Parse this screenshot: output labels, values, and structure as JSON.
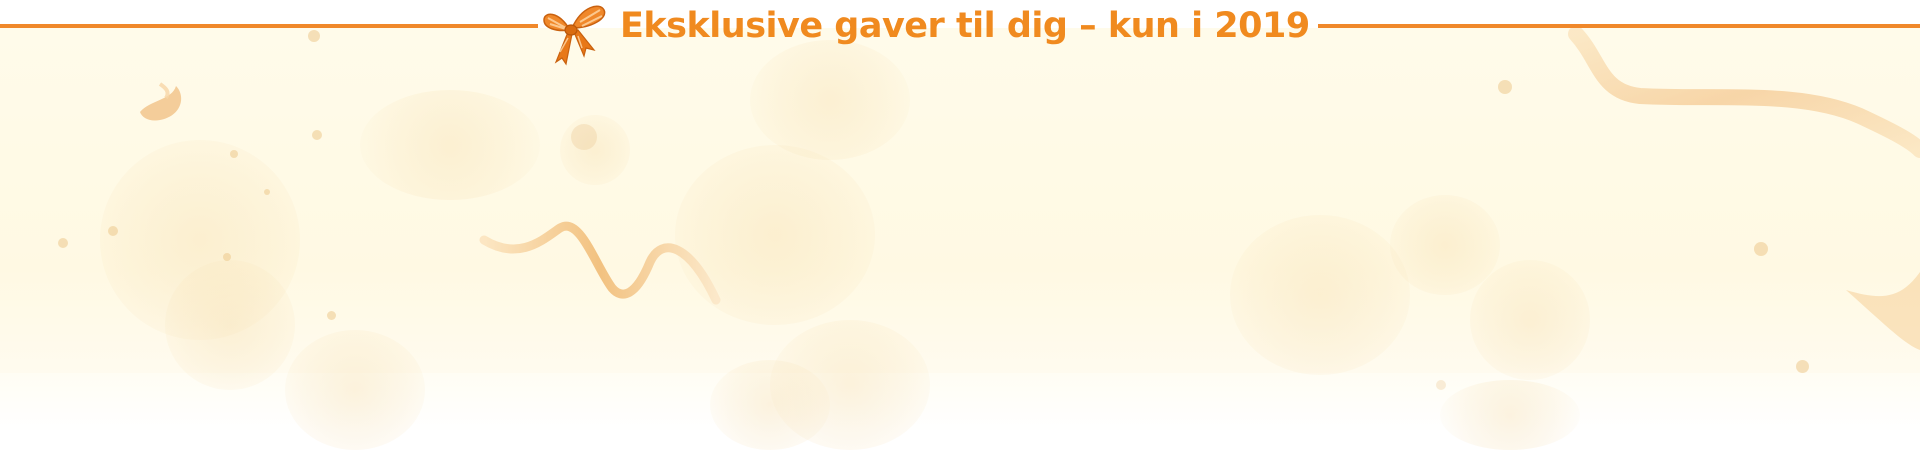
{
  "banner": {
    "title": "Eksklusive gaver til dig – kun i 2019",
    "bow_icon": "ribbon-bow-icon",
    "colors": {
      "accent_orange": "#f0882a",
      "title_orange": "#f08a1f",
      "background_cream": "#fff9e3",
      "ribbon_gold": "#f4c48a"
    }
  }
}
